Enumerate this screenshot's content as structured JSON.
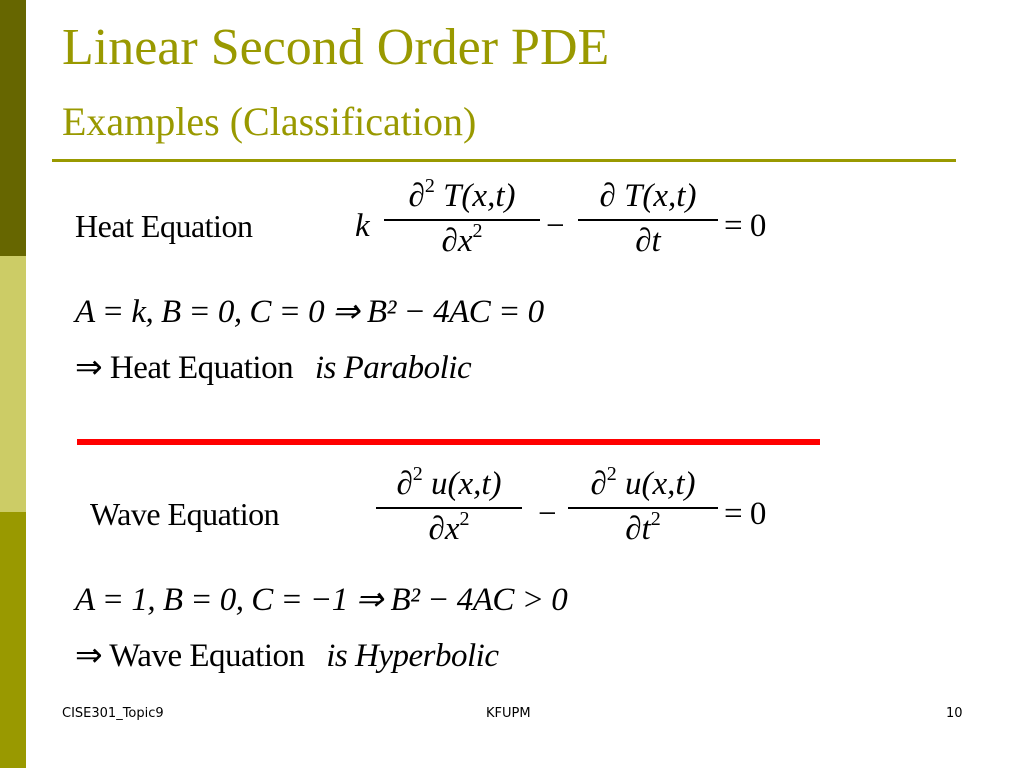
{
  "slide": {
    "title": "Linear Second Order PDE",
    "subtitle": "Examples (Classification)",
    "colors": {
      "accent": "#999900",
      "dark_olive": "#666600",
      "khaki": "#cccc66",
      "separator_red": "#ff0000"
    },
    "heat": {
      "label": "Heat Equation",
      "coef": "k",
      "frac1_num": "∂² T(x,t)",
      "frac1_den": "∂x²",
      "minus": "−",
      "frac2_num": "∂ T(x,t)",
      "frac2_den": "∂t",
      "rhs": "= 0",
      "coeffs_line": "A = k, B = 0, C = 0 ⇒ B² − 4AC = 0",
      "conclusion_prefix": "⇒ Heat Equation",
      "conclusion_suffix": "is Parabolic"
    },
    "wave": {
      "label": "Wave Equation",
      "frac1_num": "∂² u(x,t)",
      "frac1_den": "∂x²",
      "minus": "−",
      "frac2_num": "∂² u(x,t)",
      "frac2_den": "∂t²",
      "rhs": "= 0",
      "coeffs_line": "A = 1, B = 0, C = −1 ⇒ B² − 4AC > 0",
      "conclusion_prefix": "⇒ Wave Equation",
      "conclusion_suffix": "is Hyperbolic"
    }
  },
  "footer": {
    "left": "CISE301_Topic9",
    "center": "KFUPM",
    "page_number": "10"
  }
}
